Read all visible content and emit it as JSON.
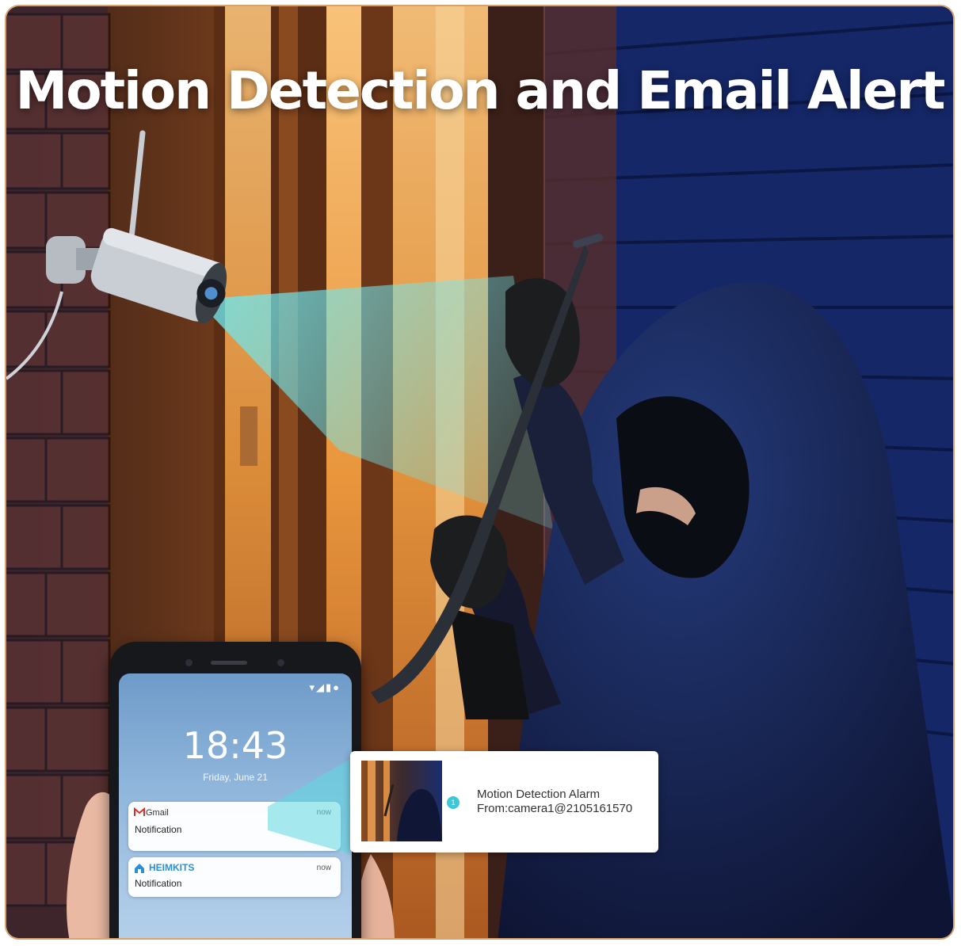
{
  "headline": "Motion Detection and Email Alert",
  "phone": {
    "status_icons": "▾◢▮●",
    "clock": "18:43",
    "date": "Friday, June 21",
    "notifications": [
      {
        "app": "Gmail",
        "time": "now",
        "text": "Notification",
        "icon": "gmail-icon"
      },
      {
        "app": "HEIMKITS",
        "time": "now",
        "text": "Notification",
        "icon": "heimkits-icon"
      }
    ]
  },
  "alert": {
    "badge": "1",
    "title": "Motion Detection Alarm",
    "from": "From:camera1@2105161570"
  },
  "colors": {
    "beam": "#5fd8e0",
    "night_blue": "#1b3a8c",
    "door_orange": "#d27a3a",
    "accent_cyan": "#3dc7d9"
  }
}
